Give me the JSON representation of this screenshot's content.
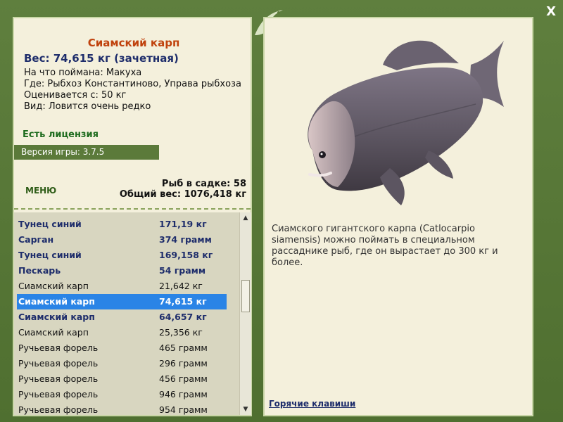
{
  "close": {
    "label": "X"
  },
  "fish_card": {
    "title": "Сиамский карп",
    "weight": "Вес: 74,615 кг (зачетная)",
    "info": [
      "На что поймана: Макуха",
      "Где: Рыбхоз Константиново, Управа рыбхоза",
      "Оценивается с: 50 кг",
      "Вид: Ловится очень редко"
    ],
    "license": "Есть лицензия",
    "version": "Версия игры: 3.7.5"
  },
  "menu": {
    "label": "МЕНЮ"
  },
  "cage": {
    "count": "Рыб в садке: 58",
    "total": "Общий вес: 1076,418 кг"
  },
  "list": [
    {
      "name": "Тунец синий",
      "weight": "171,19 кг",
      "style": "bold"
    },
    {
      "name": "Сарган",
      "weight": "374 грамм",
      "style": "bold"
    },
    {
      "name": "Тунец синий",
      "weight": "169,158 кг",
      "style": "bold"
    },
    {
      "name": "Пескарь",
      "weight": "54 грамм",
      "style": "bold"
    },
    {
      "name": "Сиамский карп",
      "weight": "21,642 кг",
      "style": "plain"
    },
    {
      "name": "Сиамский карп",
      "weight": "74,615 кг",
      "style": "sel"
    },
    {
      "name": "Сиамский карп",
      "weight": "64,657 кг",
      "style": "bold"
    },
    {
      "name": "Сиамский карп",
      "weight": "25,356 кг",
      "style": "plain"
    },
    {
      "name": "Ручьевая форель",
      "weight": "465 грамм",
      "style": "plain"
    },
    {
      "name": "Ручьевая форель",
      "weight": "296 грамм",
      "style": "plain"
    },
    {
      "name": "Ручьевая форель",
      "weight": "456 грамм",
      "style": "plain"
    },
    {
      "name": "Ручьевая форель",
      "weight": "946 грамм",
      "style": "plain"
    },
    {
      "name": "Ручьевая форель",
      "weight": "954 грамм",
      "style": "plain"
    }
  ],
  "description": "Сиамского гигантского карпа (Catlocarpio siamensis) можно поймать в специальном рассаднике рыб, где он вырастает до 300 кг и более.",
  "hotkeys": {
    "label": "Горячие клавиши"
  },
  "icons": {
    "close": "close-icon",
    "scroll_up": "scroll-up-icon",
    "scroll_down": "scroll-down-icon",
    "logo": "dolphin-logo-icon",
    "fish": "fish-image"
  },
  "colors": {
    "frame": "#5b7a3a",
    "title": "#c0420d",
    "selected": "#2a84e6",
    "name_bold": "#1e2d6b",
    "license": "#1d6b1d"
  }
}
